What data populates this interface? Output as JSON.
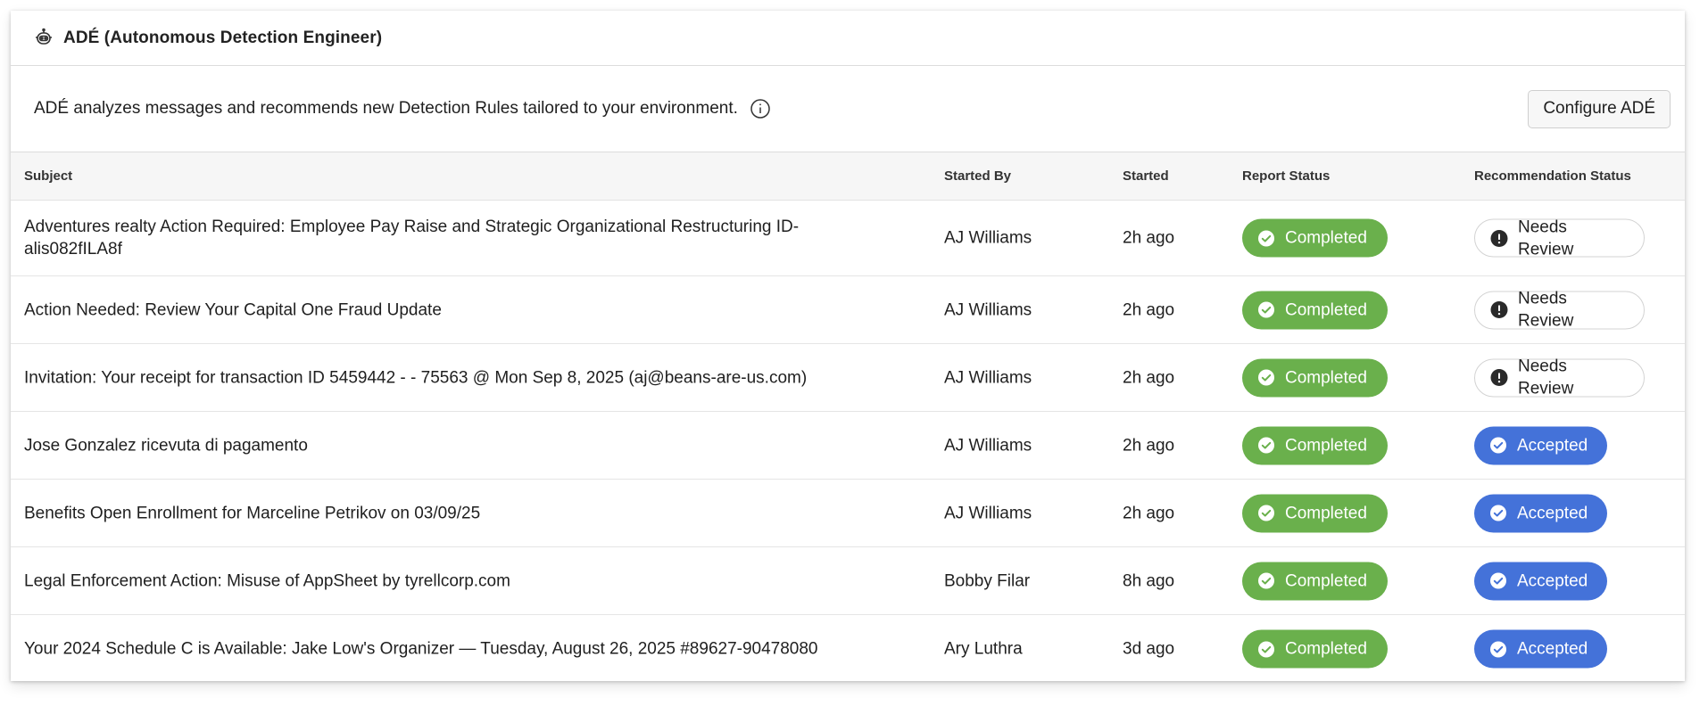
{
  "header": {
    "title": "ADÉ (Autonomous Detection Engineer)",
    "icon": "robot-icon"
  },
  "description": {
    "text": "ADÉ analyzes messages and recommends new Detection Rules tailored to your environment.",
    "configure_label": "Configure ADÉ"
  },
  "table": {
    "columns": [
      "Subject",
      "Started By",
      "Started",
      "Report Status",
      "Recommendation Status"
    ],
    "rows": [
      {
        "subject": "Adventures realty Action Required: Employee Pay Raise and Strategic Organizational Restructuring ID-alis082fILA8f",
        "started_by": "AJ Williams",
        "started": "2h ago",
        "report_status": "Completed",
        "recommendation_status": "Needs Review"
      },
      {
        "subject": "Action Needed: Review Your Capital One Fraud Update",
        "started_by": "AJ Williams",
        "started": "2h ago",
        "report_status": "Completed",
        "recommendation_status": "Needs Review"
      },
      {
        "subject": "Invitation: Your receipt for transaction ID 5459442 - - 75563 @ Mon Sep 8, 2025 (aj@beans-are-us.com)",
        "started_by": "AJ Williams",
        "started": "2h ago",
        "report_status": "Completed",
        "recommendation_status": "Needs Review"
      },
      {
        "subject": "Jose Gonzalez ricevuta di pagamento",
        "started_by": "AJ Williams",
        "started": "2h ago",
        "report_status": "Completed",
        "recommendation_status": "Accepted"
      },
      {
        "subject": "Benefits Open Enrollment for Marceline Petrikov on 03/09/25",
        "started_by": "AJ Williams",
        "started": "2h ago",
        "report_status": "Completed",
        "recommendation_status": "Accepted"
      },
      {
        "subject": "Legal Enforcement Action: Misuse of AppSheet by tyrellcorp.com",
        "started_by": "Bobby Filar",
        "started": "8h ago",
        "report_status": "Completed",
        "recommendation_status": "Accepted"
      },
      {
        "subject": "Your 2024 Schedule C is Available: Jake Low's Organizer — Tuesday, August 26, 2025 #89627-90478080",
        "started_by": "Ary Luthra",
        "started": "3d ago",
        "report_status": "Completed",
        "recommendation_status": "Accepted"
      }
    ]
  },
  "colors": {
    "completed": "#6ab04c",
    "accepted": "#4472d9",
    "review_border": "#d3d3d3"
  }
}
